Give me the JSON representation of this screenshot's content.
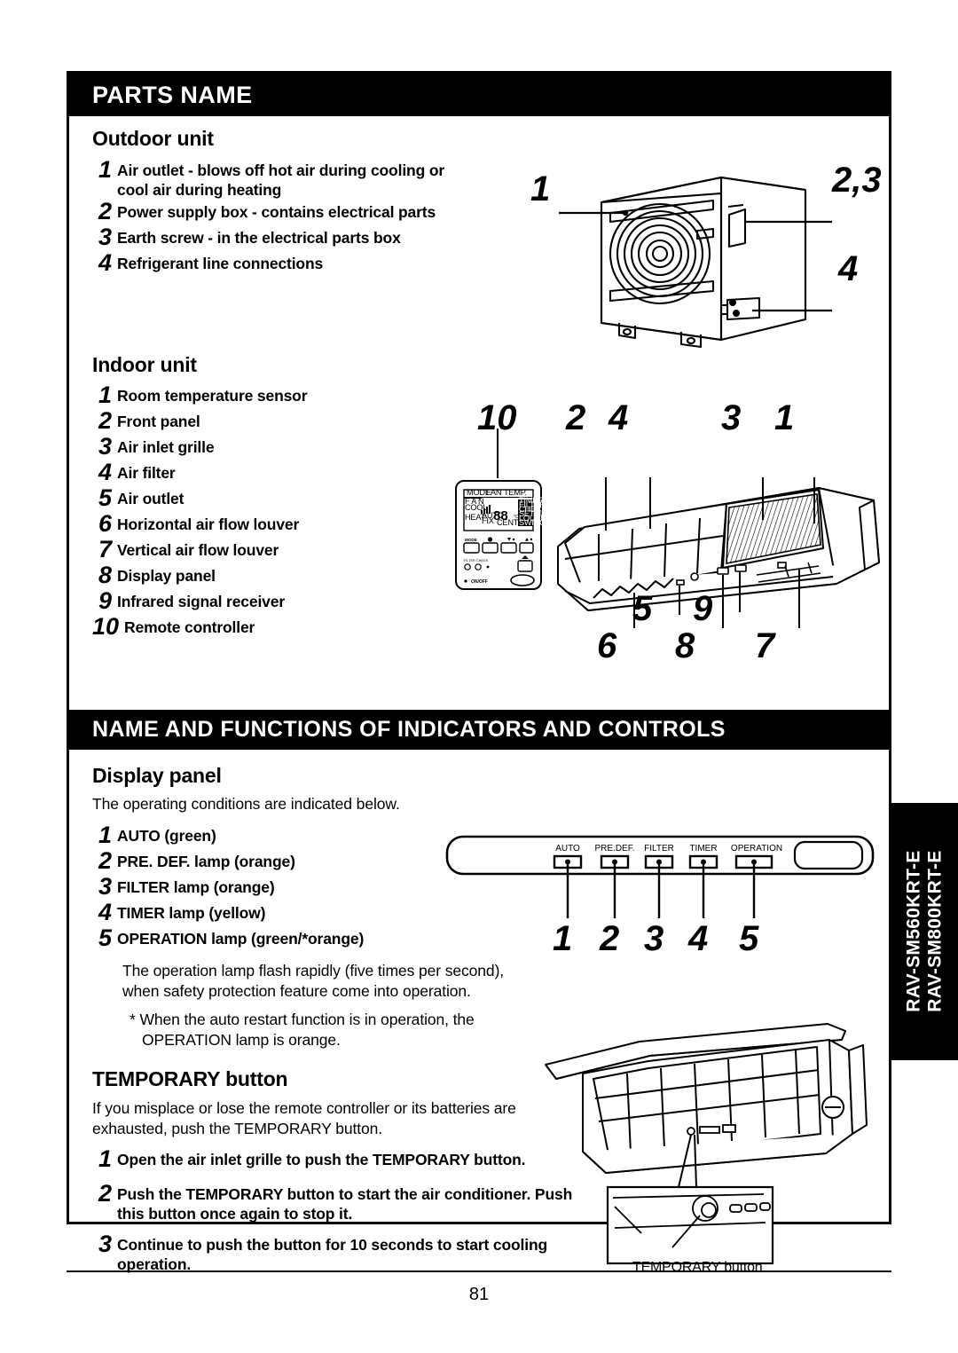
{
  "page": {
    "number": "81",
    "model_tab": {
      "line1": "RAV-SM560KRT-E",
      "line2": "RAV-SM800KRT-E"
    }
  },
  "sections": {
    "parts_name": {
      "title": "PARTS NAME",
      "outdoor": {
        "heading": "Outdoor unit",
        "items": [
          {
            "n": "1",
            "text": "Air outlet - blows off hot air during cooling or cool air during heating"
          },
          {
            "n": "2",
            "text": "Power supply box - contains electrical parts"
          },
          {
            "n": "3",
            "text": "Earth screw - in the electrical parts box"
          },
          {
            "n": "4",
            "text": "Refrigerant line connections"
          }
        ],
        "callouts": [
          "1",
          "2,3",
          "4"
        ]
      },
      "indoor": {
        "heading": "Indoor unit",
        "items": [
          {
            "n": "1",
            "text": "Room temperature sensor"
          },
          {
            "n": "2",
            "text": "Front panel"
          },
          {
            "n": "3",
            "text": "Air inlet grille"
          },
          {
            "n": "4",
            "text": "Air filter"
          },
          {
            "n": "5",
            "text": "Air outlet"
          },
          {
            "n": "6",
            "text": "Horizontal air flow louver"
          },
          {
            "n": "7",
            "text": "Vertical air flow louver"
          },
          {
            "n": "8",
            "text": "Display panel"
          },
          {
            "n": "9",
            "text": "Infrared signal receiver"
          },
          {
            "n": "10",
            "text": "Remote controller"
          }
        ],
        "callouts": [
          "10",
          "2",
          "4",
          "3",
          "1",
          "5",
          "9",
          "6",
          "8",
          "7"
        ],
        "remote_display": {
          "row_labels": [
            "MODE",
            "FAN",
            "TEMP."
          ],
          "modes": [
            "F A N",
            "COOL",
            "HEAT"
          ],
          "fan_modes": [
            "AUTO",
            "FIX"
          ],
          "digits": "88",
          "unit": "°C",
          "central": "CENTRAL",
          "right_labels": [
            "TIMER",
            "FILTER",
            "CHECK",
            "SETTING",
            "LOUVER",
            "SWING"
          ],
          "buttons": [
            "MODE"
          ],
          "filter_check": "FILTER CHECK",
          "onoff": "ON/OFF"
        }
      }
    },
    "indicators": {
      "title": "NAME AND FUNCTIONS OF INDICATORS AND CONTROLS",
      "display_panel": {
        "heading": "Display panel",
        "intro": "The operating conditions are indicated below.",
        "items": [
          {
            "n": "1",
            "text": "AUTO (green)"
          },
          {
            "n": "2",
            "text": "PRE. DEF. lamp (orange)"
          },
          {
            "n": "3",
            "text": "FILTER lamp (orange)"
          },
          {
            "n": "4",
            "text": "TIMER lamp (yellow)"
          },
          {
            "n": "5",
            "text": "OPERATION lamp (green/*orange)"
          }
        ],
        "note": "The operation lamp flash rapidly (five times per second), when safety protection feature come into operation.",
        "footnote": "* When the auto restart function is in operation, the OPERATION lamp is orange.",
        "diagram": {
          "lamp_labels": [
            "AUTO",
            "PRE.DEF.",
            "FILTER",
            "TIMER",
            "OPERATION"
          ],
          "callouts": [
            "1",
            "2",
            "3",
            "4",
            "5"
          ]
        }
      },
      "temporary_button": {
        "heading": "TEMPORARY button",
        "intro": "If you misplace or lose the remote controller or its batteries are exhausted, push the TEMPORARY button.",
        "items": [
          {
            "n": "1",
            "text": "Open the air inlet grille to push the TEMPORARY button."
          },
          {
            "n": "2",
            "text": "Push the TEMPORARY button to start the air conditioner. Push this button once again to stop it."
          },
          {
            "n": "3",
            "text": "Continue to push the button for 10 seconds to start cooling operation."
          }
        ],
        "diagram_caption": "TEMPORARY button"
      }
    }
  },
  "colors": {
    "ink": "#000000",
    "paper": "#ffffff"
  }
}
